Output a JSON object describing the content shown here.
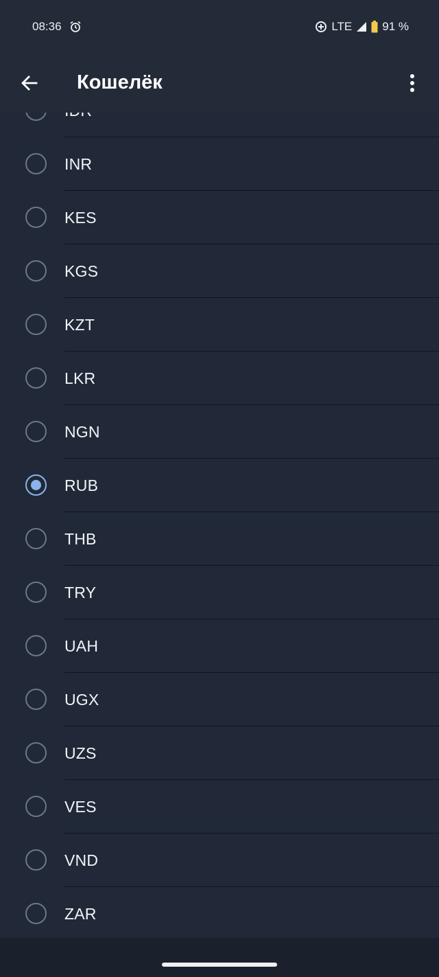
{
  "status_bar": {
    "time": "08:36",
    "network": "LTE",
    "battery": "91 %",
    "icons": [
      "alarm-icon",
      "data-saver-icon",
      "signal-icon",
      "battery-icon"
    ]
  },
  "app_bar": {
    "title": "Кошелёк",
    "back_icon": "arrow-left-icon",
    "menu_icon": "more-vert-icon"
  },
  "currency_list": {
    "selected": "RUB",
    "accent_color": "#8ab4ea",
    "items": [
      {
        "code": "IDR",
        "checked": false
      },
      {
        "code": "INR",
        "checked": false
      },
      {
        "code": "KES",
        "checked": false
      },
      {
        "code": "KGS",
        "checked": false
      },
      {
        "code": "KZT",
        "checked": false
      },
      {
        "code": "LKR",
        "checked": false
      },
      {
        "code": "NGN",
        "checked": false
      },
      {
        "code": "RUB",
        "checked": true
      },
      {
        "code": "THB",
        "checked": false
      },
      {
        "code": "TRY",
        "checked": false
      },
      {
        "code": "UAH",
        "checked": false
      },
      {
        "code": "UGX",
        "checked": false
      },
      {
        "code": "UZS",
        "checked": false
      },
      {
        "code": "VES",
        "checked": false
      },
      {
        "code": "VND",
        "checked": false
      },
      {
        "code": "ZAR",
        "checked": false
      }
    ]
  }
}
